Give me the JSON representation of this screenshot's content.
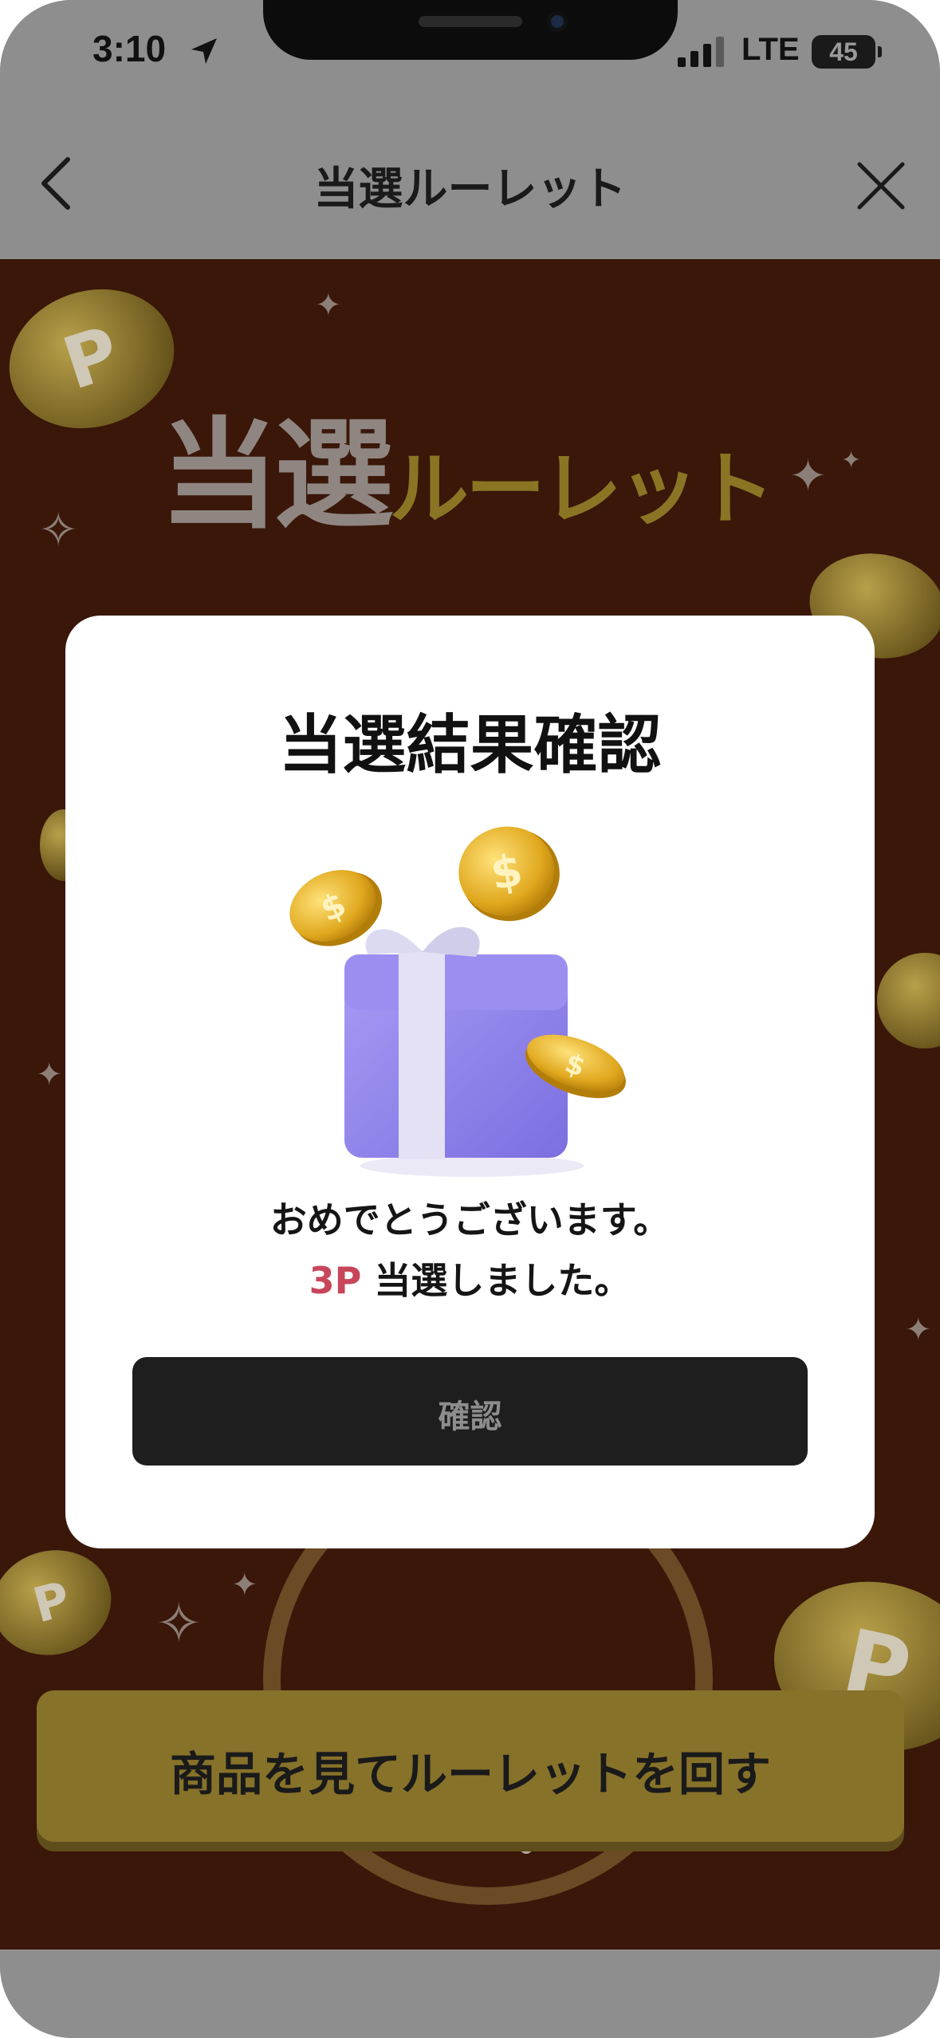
{
  "status_bar": {
    "time": "3:10",
    "network": "LTE",
    "battery": "45",
    "location_icon": "location-arrow-icon",
    "signal_icon": "cellular-signal-icon"
  },
  "nav": {
    "title": "当選ルーレット",
    "back_icon": "chevron-left-icon",
    "close_icon": "close-icon"
  },
  "hero": {
    "title_main": "当選",
    "title_sub": "ルーレット"
  },
  "background": {
    "coin_letter": "P",
    "spin_button_label": "商品を見てルーレットを回す"
  },
  "modal": {
    "title": "当選結果確認",
    "illustration_icon": "gift-box-with-coins-icon",
    "coin_symbol": "$",
    "message_line1": "おめでとうございます。",
    "prize_points": "3P",
    "message_line2_suffix": " 当選しました。",
    "confirm_label": "確認"
  },
  "colors": {
    "modal_bg": "#ffffff",
    "confirm_button_bg": "#1e1e1e",
    "prize_accent": "#c7465a",
    "dimmed_brown_bg": "#3a1709",
    "dimmed_gold": "#87722a"
  }
}
